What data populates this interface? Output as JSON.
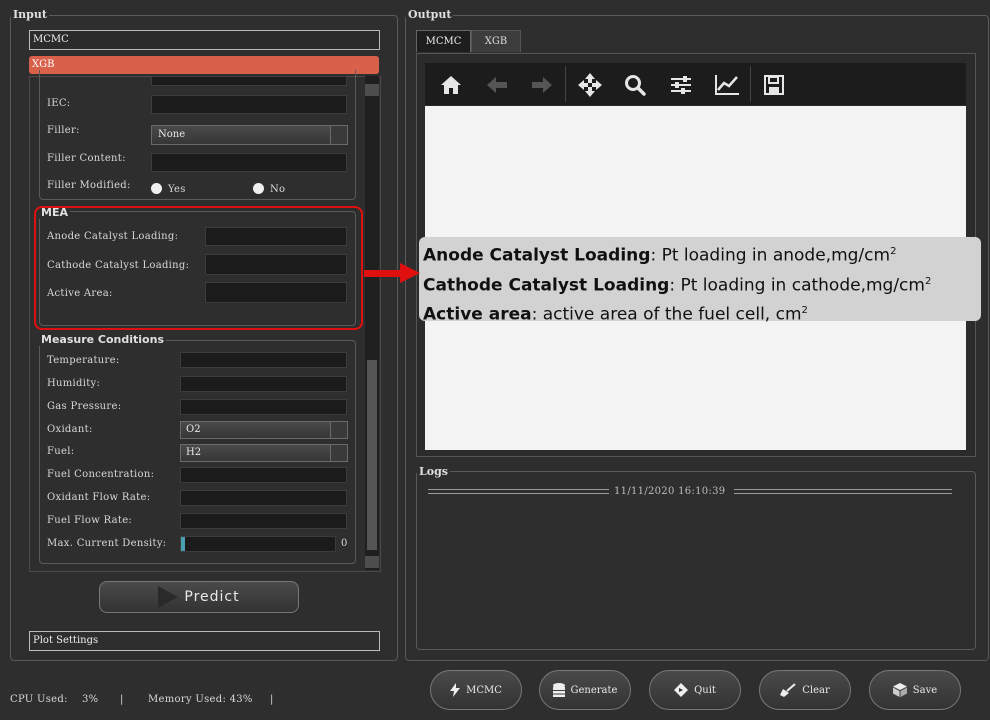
{
  "input_panel": {
    "title": "Input",
    "model_items": [
      "MCMC",
      "XGB"
    ],
    "membrane_fields": {
      "iec_label": "IEC:",
      "filler_label": "Filler:",
      "filler_value": "None",
      "filler_content_label": "Filler Content:",
      "filler_modified_label": "Filler Modified:",
      "yes_label": "Yes",
      "no_label": "No"
    },
    "mea": {
      "title": "MEA",
      "anode_label": "Anode Catalyst Loading:",
      "cathode_label": "Cathode Catalyst Loading:",
      "area_label": "Active Area:"
    },
    "measure": {
      "title": "Measure Conditions",
      "temperature_label": "Temperature:",
      "humidity_label": "Humidity:",
      "gas_pressure_label": "Gas Pressure:",
      "oxidant_label": "Oxidant:",
      "oxidant_value": "O2",
      "fuel_label": "Fuel:",
      "fuel_value": "H2",
      "fuel_conc_label": "Fuel Concentration:",
      "oxidant_flow_label": "Oxidant Flow Rate:",
      "fuel_flow_label": "Fuel Flow Rate:",
      "max_current_label": "Max. Current Density:",
      "max_current_value": "0"
    },
    "predict_label": "Predict",
    "plot_settings_label": "Plot Settings"
  },
  "output_panel": {
    "title": "Output",
    "tabs": [
      "MCMC",
      "XGB"
    ],
    "toolbar_icons": [
      "home-icon",
      "back-arrow-icon",
      "forward-arrow-icon",
      "pan-icon",
      "zoom-icon",
      "configure-icon",
      "edit-axis-icon",
      "save-icon"
    ],
    "logs_title": "Logs",
    "log_timestamp": "11/11/2020 16:10:39"
  },
  "tooltip": {
    "line1_bold": "Anode Catalyst Loading",
    "line1_rest": ": Pt loading in anode,mg/cm",
    "line2_bold": "Cathode Catalyst Loading",
    "line2_rest": ": Pt loading in cathode,mg/cm",
    "line3_bold": "Active area",
    "line3_rest": ": active area of the fuel cell, cm",
    "superscript": "2"
  },
  "bottom_buttons": {
    "mcmc": "MCMC",
    "generate": "Generate",
    "quit": "Quit",
    "clear": "Clear",
    "save": "Save"
  },
  "status": {
    "cpu_label": "CPU Used:",
    "cpu_value": "3%",
    "memory_label": "Memory Used: 43%",
    "sep": "|"
  },
  "colors": {
    "accent": "#d9604a",
    "highlight": "#e01010",
    "background": "#2e2e2e"
  }
}
